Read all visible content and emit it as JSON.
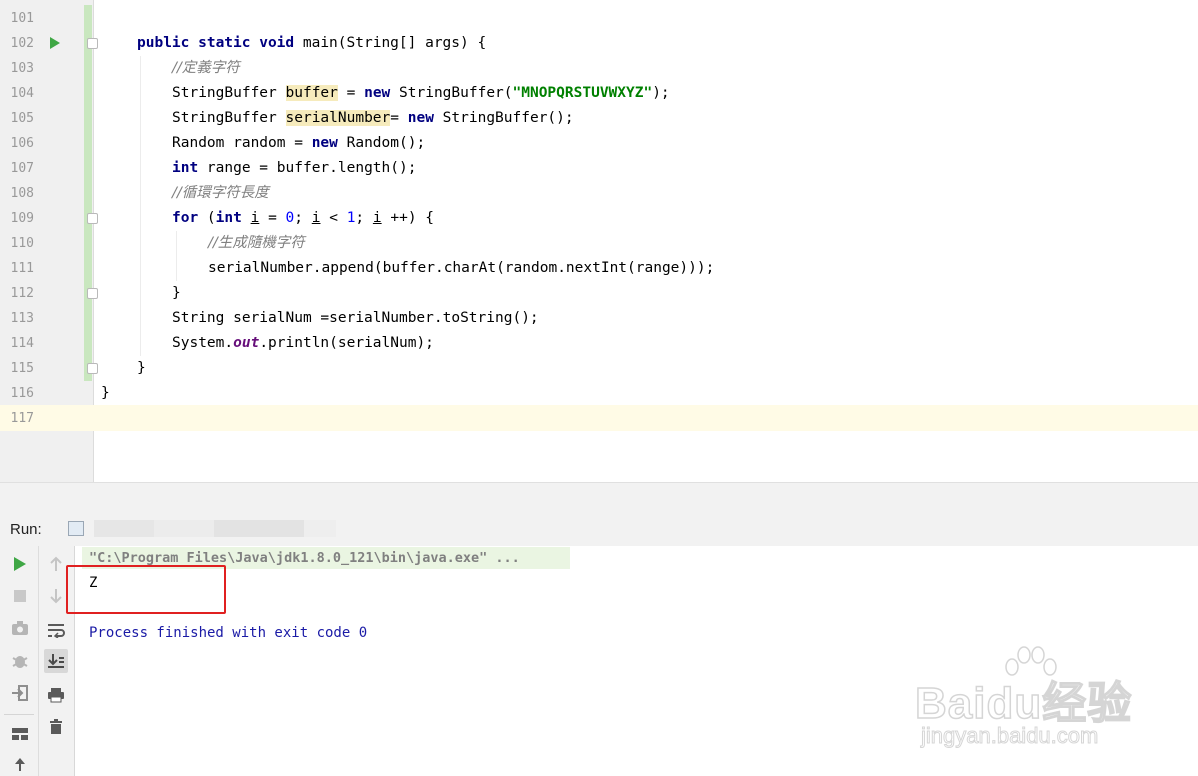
{
  "editor": {
    "lines": [
      {
        "num": "101"
      },
      {
        "num": "102"
      },
      {
        "num": "103"
      },
      {
        "num": "104"
      },
      {
        "num": "105"
      },
      {
        "num": "106"
      },
      {
        "num": "107"
      },
      {
        "num": "108"
      },
      {
        "num": "109"
      },
      {
        "num": "110"
      },
      {
        "num": "111"
      },
      {
        "num": "112"
      },
      {
        "num": "113"
      },
      {
        "num": "114"
      },
      {
        "num": "115"
      },
      {
        "num": "116"
      },
      {
        "num": "117"
      }
    ],
    "code": {
      "l102": {
        "kw": "public static void",
        "rest": " main(String[] args) {"
      },
      "l103": {
        "comment": "//定義字符"
      },
      "l104": {
        "a": "StringBuffer ",
        "var": "buffer",
        "b": " = ",
        "kw": "new",
        "c": " StringBuffer(",
        "str": "\"MNOPQRSTUVWXYZ\"",
        "d": ");"
      },
      "l105": {
        "a": "StringBuffer ",
        "var": "serialNumber",
        "b": "= ",
        "kw": "new",
        "c": " StringBuffer();"
      },
      "l106": {
        "a": "Random random = ",
        "kw": "new",
        "c": " Random();"
      },
      "l107": {
        "kw": "int",
        "rest": " range = buffer.length();"
      },
      "l108": {
        "comment": "//循環字符長度"
      },
      "l109": {
        "kw": "for",
        "a": " (",
        "kw2": "int",
        "sp": " ",
        "i1": "i",
        "b": " = ",
        "n0": "0",
        "c": "; ",
        "i2": "i",
        "d": " < ",
        "n1": "1",
        "e": "; ",
        "i3": "i",
        "f": " ++) {"
      },
      "l110": {
        "comment": "//生成隨機字符"
      },
      "l111": {
        "text": "serialNumber.append(buffer.charAt(random.nextInt(range)));"
      },
      "l112": {
        "text": "}"
      },
      "l113": {
        "text": "String serialNum =serialNumber.toString();"
      },
      "l114": {
        "a": "System.",
        "field": "out",
        "b": ".println(serialNum);"
      },
      "l115": {
        "text": "}"
      },
      "l116": {
        "text": "}"
      }
    }
  },
  "run_panel": {
    "label": "Run:",
    "console": {
      "command": "\"C:\\Program Files\\Java\\jdk1.8.0_121\\bin\\java.exe\" ...",
      "output": "Z",
      "exit_message": "Process finished with exit code 0"
    },
    "toolbar_icons": [
      "run-icon",
      "up-arrow-icon",
      "stop-icon",
      "down-arrow-icon",
      "camera-icon",
      "soft-wrap-icon",
      "debug-icon",
      "scroll-to-end-icon",
      "login-icon",
      "print-icon",
      "trash-icon",
      "layout-icon",
      "pin-icon"
    ]
  },
  "colors": {
    "keyword": "#000080",
    "comment": "#808080",
    "string": "#008000",
    "number": "#0000ff",
    "highlight_box": "#e02020",
    "run_green": "#3fa745"
  },
  "watermark": {
    "brand": "Baidu经验",
    "domain": "jingyan.baidu.com"
  }
}
